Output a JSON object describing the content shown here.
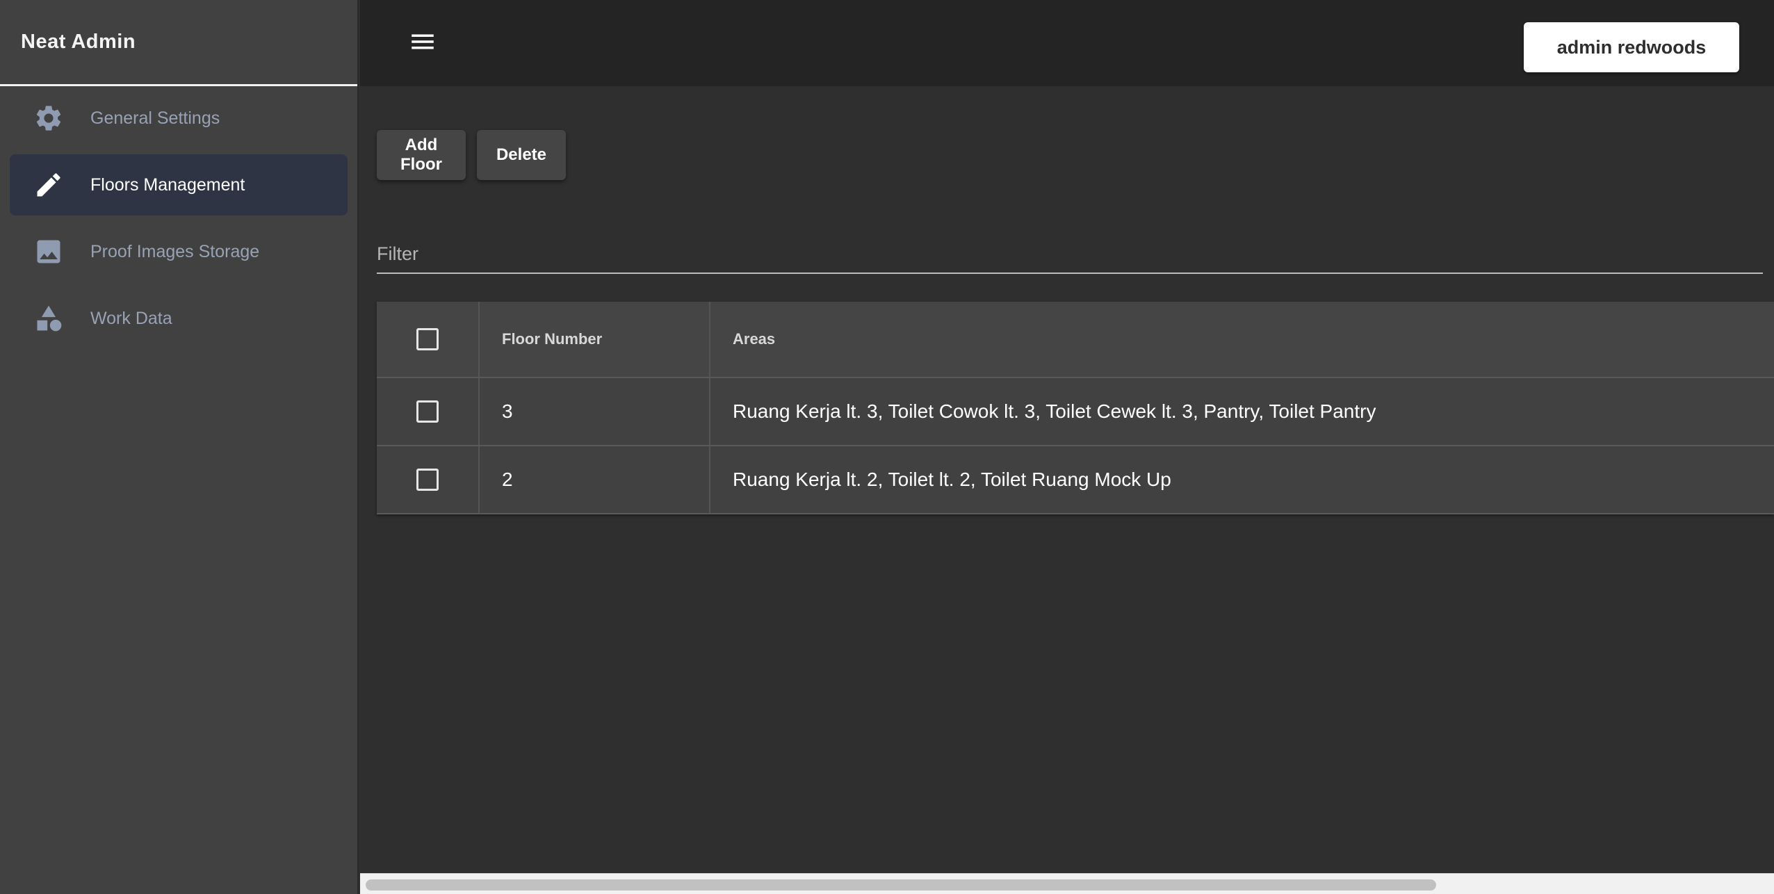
{
  "app": {
    "title": "Neat Admin"
  },
  "sidebar": {
    "items": [
      {
        "label": "General Settings",
        "icon": "gear-icon",
        "active": false
      },
      {
        "label": "Floors Management",
        "icon": "pencil-icon",
        "active": true
      },
      {
        "label": "Proof Images Storage",
        "icon": "image-icon",
        "active": false
      },
      {
        "label": "Work Data",
        "icon": "shapes-icon",
        "active": false
      }
    ]
  },
  "topbar": {
    "menu_icon": "hamburger-menu-icon",
    "user_label": "admin redwoods"
  },
  "toolbar": {
    "add_label": "Add Floor",
    "delete_label": "Delete"
  },
  "filter": {
    "placeholder": "Filter",
    "value": ""
  },
  "table": {
    "headers": {
      "floor": "Floor Number",
      "areas": "Areas"
    },
    "rows": [
      {
        "floor": "3",
        "areas": "Ruang Kerja lt. 3, Toilet Cowok lt. 3, Toilet Cewek lt. 3, Pantry, Toilet Pantry"
      },
      {
        "floor": "2",
        "areas": "Ruang Kerja lt. 2, Toilet lt. 2, Toilet Ruang Mock Up"
      }
    ]
  },
  "colors": {
    "sidebar_bg": "#414141",
    "topbar_bg": "#242424",
    "main_bg": "#2f2f2f",
    "active_item_bg": "#2e3444",
    "inactive_text": "#98a2b4"
  }
}
